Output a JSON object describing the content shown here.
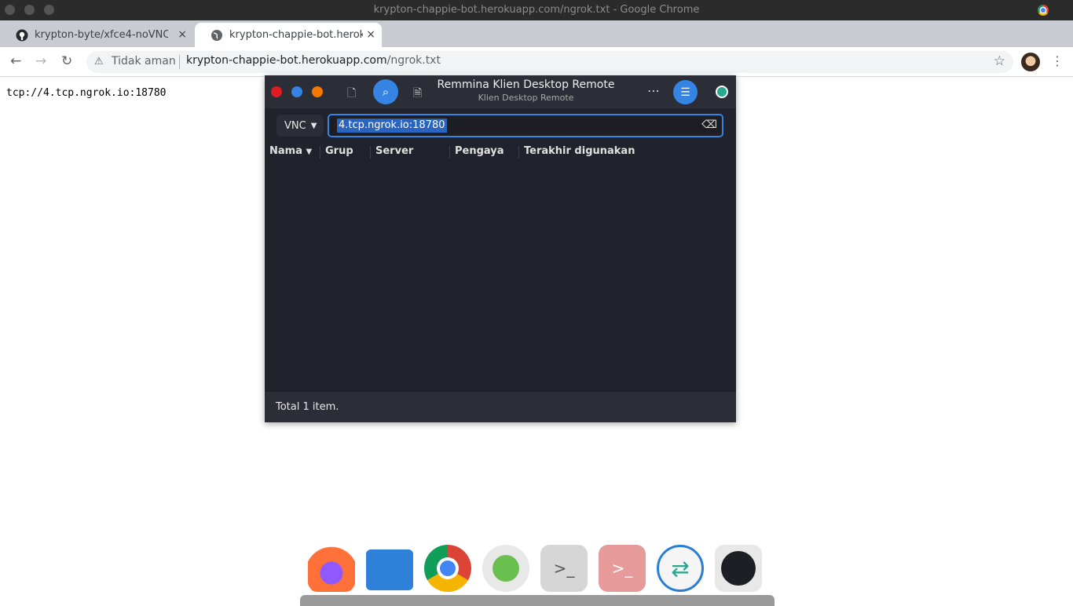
{
  "window": {
    "title": "krypton-chappie-bot.herokuapp.com/ngrok.txt - Google Chrome"
  },
  "tabs": [
    {
      "label": "krypton-byte/xfce4-noVNC",
      "close": "×"
    },
    {
      "label": "krypton-chappie-bot.herokuapp.com",
      "close": "×"
    }
  ],
  "newtab": "+",
  "omnibox": {
    "security": "Tidak aman",
    "url_host": "krypton-chappie-bot.herokuapp.com",
    "url_path": "/ngrok.txt"
  },
  "page": {
    "content": "tcp://4.tcp.ngrok.io:18780"
  },
  "remmina": {
    "title": "Remmina Klien Desktop Remote",
    "subtitle": "Klien Desktop Remote",
    "protocol": "VNC",
    "address": "4.tcp.ngrok.io:18780",
    "columns": [
      "Nama",
      "Grup",
      "Server",
      "Pengaya",
      "Terakhir digunakan"
    ],
    "status": "Total 1 item.",
    "colors": {
      "accent": "#3584e4",
      "close": "#e01b24",
      "minimize": "#3584e4",
      "maximize": "#f57900"
    }
  },
  "dock": {
    "apps": [
      "firefox-icon",
      "files-icon",
      "chrome-icon",
      "android-icon",
      "terminal-icon",
      "terminal-red-icon",
      "remmina-icon",
      "clock-icon"
    ]
  }
}
